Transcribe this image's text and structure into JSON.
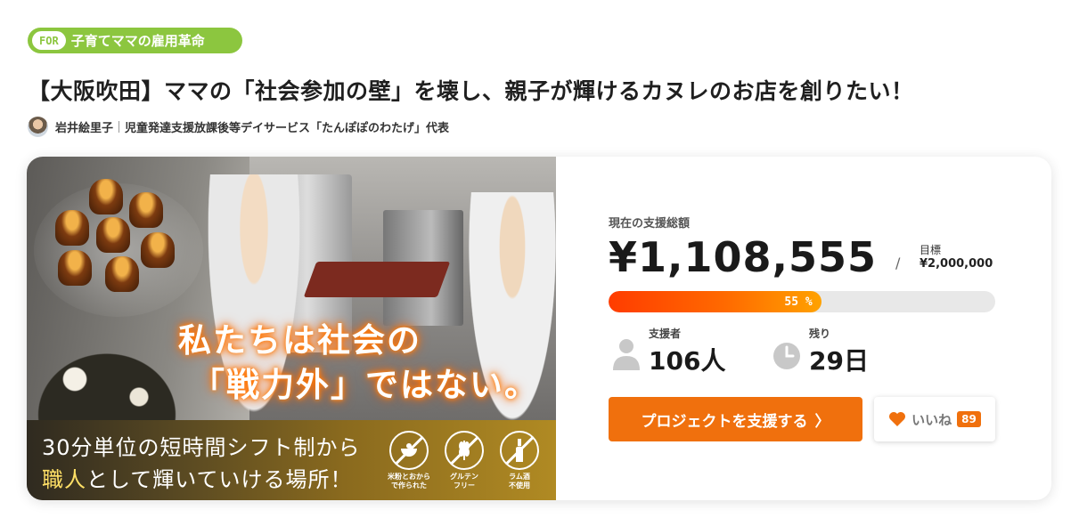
{
  "tag": {
    "prefix": "FOR",
    "text": "子育てママの雇用革命"
  },
  "title": "【大阪吹田】ママの「社会参加の壁」を壊し、親子が輝けるカヌレのお店を創りたい！",
  "owner": {
    "name": "岩井絵里子",
    "role": "児童発達支援放課後等デイサービス「たんぽぽのわたげ」代表"
  },
  "hero": {
    "headline_line1": "私たちは社会の",
    "headline_line2": "「戦力外」ではない。",
    "banner_line1": "30分単位の短時間シフト制から",
    "banner_line2_highlight": "職人",
    "banner_line2_rest": "として輝いていける場所！",
    "badges": [
      {
        "icon": "rice-bowl-icon",
        "label_1": "米粉とおから",
        "label_2": "で作られた"
      },
      {
        "icon": "wheat-icon",
        "label_1": "グルテン",
        "label_2": "フリー"
      },
      {
        "icon": "bottle-icon",
        "label_1": "ラム酒",
        "label_2": "不使用"
      }
    ]
  },
  "funding": {
    "raised_label": "現在の支援総額",
    "raised_amount": "¥1,108,555",
    "slash": "/",
    "goal_label": "目標",
    "goal_amount": "¥2,000,000",
    "progress_percent": 55,
    "progress_text": "55 %",
    "supporters_label": "支援者",
    "supporters_value": "106人",
    "remaining_label": "残り",
    "remaining_value": "29日",
    "support_button": "プロジェクトを支援する",
    "support_arrow": "〉",
    "like_label": "いいね",
    "like_count": "89"
  },
  "colors": {
    "accent_orange": "#f0700d",
    "tag_green": "#8cc63f",
    "progress_start": "#ff3c00",
    "progress_end": "#ffa200"
  }
}
